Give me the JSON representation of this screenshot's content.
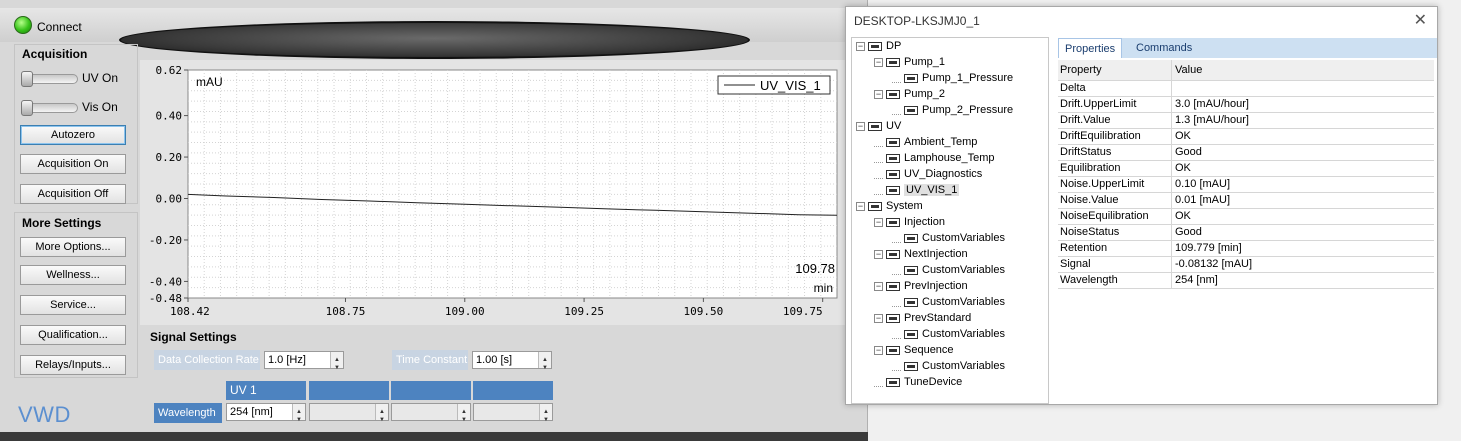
{
  "instrument": {
    "connect_label": "Connect",
    "acquisition_title": "Acquisition",
    "uv_on_label": "UV On",
    "vis_on_label": "Vis On",
    "autozero_label": "Autozero",
    "acq_on_label": "Acquisition On",
    "acq_off_label": "Acquisition Off",
    "more_settings_title": "More Settings",
    "more_buttons": [
      "More Options...",
      "Wellness...",
      "Service...",
      "Qualification...",
      "Relays/Inputs..."
    ],
    "module_label": "VWD",
    "colors": {
      "led": "#36c219",
      "accent": "#4d83c0",
      "module_label": "#5b8fd0"
    }
  },
  "signal_settings": {
    "title": "Signal Settings",
    "data_collection_rate_label": "Data Collection Rate",
    "data_collection_rate_value": "1.0 [Hz]",
    "time_constant_label": "Time Constant",
    "time_constant_value": "1.00 [s]",
    "column_headers": [
      "UV 1",
      "",
      "",
      ""
    ],
    "wavelength_label": "Wavelength",
    "wavelength_values": [
      "254 [nm]",
      "",
      "",
      ""
    ]
  },
  "chart_data": {
    "type": "line",
    "ylabel": "mAU",
    "legend": "UV_VIS_1",
    "legend_position": "top-right",
    "grid": true,
    "xlim": [
      108.42,
      109.78
    ],
    "ylim": [
      -0.48,
      0.62
    ],
    "x_ticks": [
      "108.42",
      "108.75",
      "109.00",
      "109.25",
      "109.50",
      "109.75"
    ],
    "x_tick_values": [
      108.42,
      108.75,
      109.0,
      109.25,
      109.5,
      109.75
    ],
    "y_ticks": [
      "0.62",
      "0.40",
      "0.20",
      "0.00",
      "-0.20",
      "-0.40",
      "-0.48"
    ],
    "y_tick_values": [
      0.62,
      0.4,
      0.2,
      0.0,
      -0.2,
      -0.4,
      -0.48
    ],
    "current_time": "109.78",
    "time_unit": "min",
    "series": [
      {
        "name": "UV_VIS_1",
        "x": [
          108.42,
          108.5,
          108.6,
          108.7,
          108.8,
          108.9,
          109.0,
          109.1,
          109.2,
          109.3,
          109.4,
          109.5,
          109.6,
          109.7,
          109.78
        ],
        "y": [
          0.02,
          0.012,
          0.005,
          -0.005,
          -0.012,
          -0.02,
          -0.028,
          -0.035,
          -0.042,
          -0.05,
          -0.057,
          -0.064,
          -0.071,
          -0.078,
          -0.081
        ]
      }
    ]
  },
  "window": {
    "title": "DESKTOP-LKSJMJ0_1",
    "close_glyph": "✕",
    "tree": [
      {
        "label": "DP",
        "level": 0,
        "exp": "−"
      },
      {
        "label": "Pump_1",
        "level": 1,
        "exp": "−"
      },
      {
        "label": "Pump_1_Pressure",
        "level": 2,
        "exp": ""
      },
      {
        "label": "Pump_2",
        "level": 1,
        "exp": "−"
      },
      {
        "label": "Pump_2_Pressure",
        "level": 2,
        "exp": ""
      },
      {
        "label": "UV",
        "level": 0,
        "exp": "−"
      },
      {
        "label": "Ambient_Temp",
        "level": 1,
        "exp": ""
      },
      {
        "label": "Lamphouse_Temp",
        "level": 1,
        "exp": ""
      },
      {
        "label": "UV_Diagnostics",
        "level": 1,
        "exp": ""
      },
      {
        "label": "UV_VIS_1",
        "level": 1,
        "exp": "",
        "selected": true
      },
      {
        "label": "System",
        "level": 0,
        "exp": "−"
      },
      {
        "label": "Injection",
        "level": 1,
        "exp": "−"
      },
      {
        "label": "CustomVariables",
        "level": 2,
        "exp": ""
      },
      {
        "label": "NextInjection",
        "level": 1,
        "exp": "−"
      },
      {
        "label": "CustomVariables",
        "level": 2,
        "exp": ""
      },
      {
        "label": "PrevInjection",
        "level": 1,
        "exp": "−"
      },
      {
        "label": "CustomVariables",
        "level": 2,
        "exp": ""
      },
      {
        "label": "PrevStandard",
        "level": 1,
        "exp": "−"
      },
      {
        "label": "CustomVariables",
        "level": 2,
        "exp": ""
      },
      {
        "label": "Sequence",
        "level": 1,
        "exp": "−"
      },
      {
        "label": "CustomVariables",
        "level": 2,
        "exp": ""
      },
      {
        "label": "TuneDevice",
        "level": 1,
        "exp": ""
      }
    ],
    "tabs": [
      "Properties",
      "Commands"
    ],
    "grid_header": [
      "Property",
      "Value"
    ],
    "properties": [
      [
        "Delta",
        ""
      ],
      [
        "Drift.UpperLimit",
        "3.0 [mAU/hour]"
      ],
      [
        "Drift.Value",
        "1.3 [mAU/hour]"
      ],
      [
        "DriftEquilibration",
        "OK"
      ],
      [
        "DriftStatus",
        "Good"
      ],
      [
        "Equilibration",
        "OK"
      ],
      [
        "Noise.UpperLimit",
        "0.10 [mAU]"
      ],
      [
        "Noise.Value",
        "0.01 [mAU]"
      ],
      [
        "NoiseEquilibration",
        "OK"
      ],
      [
        "NoiseStatus",
        "Good"
      ],
      [
        "Retention",
        "109.779 [min]"
      ],
      [
        "Signal",
        "-0.08132 [mAU]"
      ],
      [
        "Wavelength",
        "254 [nm]"
      ]
    ]
  }
}
